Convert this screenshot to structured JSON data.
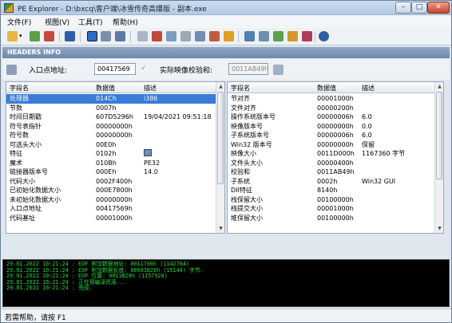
{
  "window": {
    "title": "PE Explorer - D:\\bxcq\\客户端\\冰雪传奇高爆版 - 副本.exe"
  },
  "menu": [
    "文件(F)",
    "视图(V)",
    "工具(T)",
    "帮助(H)"
  ],
  "section_title": "HEADERS INFO",
  "entry_point": {
    "label": "入口点地址:",
    "value": "00417569"
  },
  "checksum": {
    "label": "实际映像校验和:",
    "value": "0011AB49h"
  },
  "left_table": {
    "columns": [
      "字段名",
      "数据值",
      "描述"
    ],
    "rows": [
      {
        "field": "处理器",
        "value": "014Ch",
        "desc": "i386",
        "selected": true
      },
      {
        "field": "节数",
        "value": "0007h",
        "desc": ""
      },
      {
        "field": "时间日期戳",
        "value": "607D5296h",
        "desc": "19/04/2021  09:51:18"
      },
      {
        "field": "符号表指针",
        "value": "00000000h",
        "desc": ""
      },
      {
        "field": "符号数",
        "value": "00000000h",
        "desc": ""
      },
      {
        "field": "可选头大小",
        "value": "00E0h",
        "desc": ""
      },
      {
        "field": "特征",
        "value": "0102h",
        "desc": ""
      },
      {
        "field": "魔术",
        "value": "010Bh",
        "desc": "PE32"
      },
      {
        "field": "链接器版本号",
        "value": "000Eh",
        "desc": "14.0"
      },
      {
        "field": "代码大小",
        "value": "0002F400h",
        "desc": ""
      },
      {
        "field": "已初始化数据大小",
        "value": "000E7800h",
        "desc": ""
      },
      {
        "field": "未初始化数据大小",
        "value": "00000000h",
        "desc": ""
      },
      {
        "field": "入口点地址",
        "value": "00417569h",
        "desc": ""
      },
      {
        "field": "代码基址",
        "value": "00001000h",
        "desc": ""
      }
    ]
  },
  "right_table": {
    "columns": [
      "字段名",
      "数据值",
      "描述"
    ],
    "rows": [
      {
        "field": "节对齐",
        "value": "00001000h",
        "desc": ""
      },
      {
        "field": "文件对齐",
        "value": "00000200h",
        "desc": ""
      },
      {
        "field": "操作系统版本号",
        "value": "00000006h",
        "desc": "6.0"
      },
      {
        "field": "映像版本号",
        "value": "00000000h",
        "desc": "0.0"
      },
      {
        "field": "子系统版本号",
        "value": "00000006h",
        "desc": "6.0"
      },
      {
        "field": "Win32 版本号",
        "value": "00000000h",
        "desc": "保留"
      },
      {
        "field": "映像大小",
        "value": "0011D000h",
        "desc": "1167360 字节"
      },
      {
        "field": "文件头大小",
        "value": "00000400h",
        "desc": ""
      },
      {
        "field": "校验和",
        "value": "0011AB49h",
        "desc": ""
      },
      {
        "field": "子系统",
        "value": "0002h",
        "desc": "Win32 GUI"
      },
      {
        "field": "DII特征",
        "value": "8140h",
        "desc": ""
      },
      {
        "field": "栈保留大小",
        "value": "00100000h",
        "desc": ""
      },
      {
        "field": "栈提交大小",
        "value": "00001000h",
        "desc": ""
      },
      {
        "field": "堆保留大小",
        "value": "00100000h",
        "desc": ""
      }
    ]
  },
  "log": [
    "29.01.2022 10:21:24 : EOF 附加数据地址: 0011700h  (1142784)",
    "29.01.2022 10:21:24 : EOF 附加数据长度: 00003B28h  (15144) 字节.",
    "29.01.2022 10:21:24 : EOF 位置: 0011B28h  (1157928)",
    "29.01.2022 10:21:24 : 正在预编译资源...",
    "29.01.2022 10:21:24 : 完成."
  ],
  "status": "若需帮助，请按 F1"
}
